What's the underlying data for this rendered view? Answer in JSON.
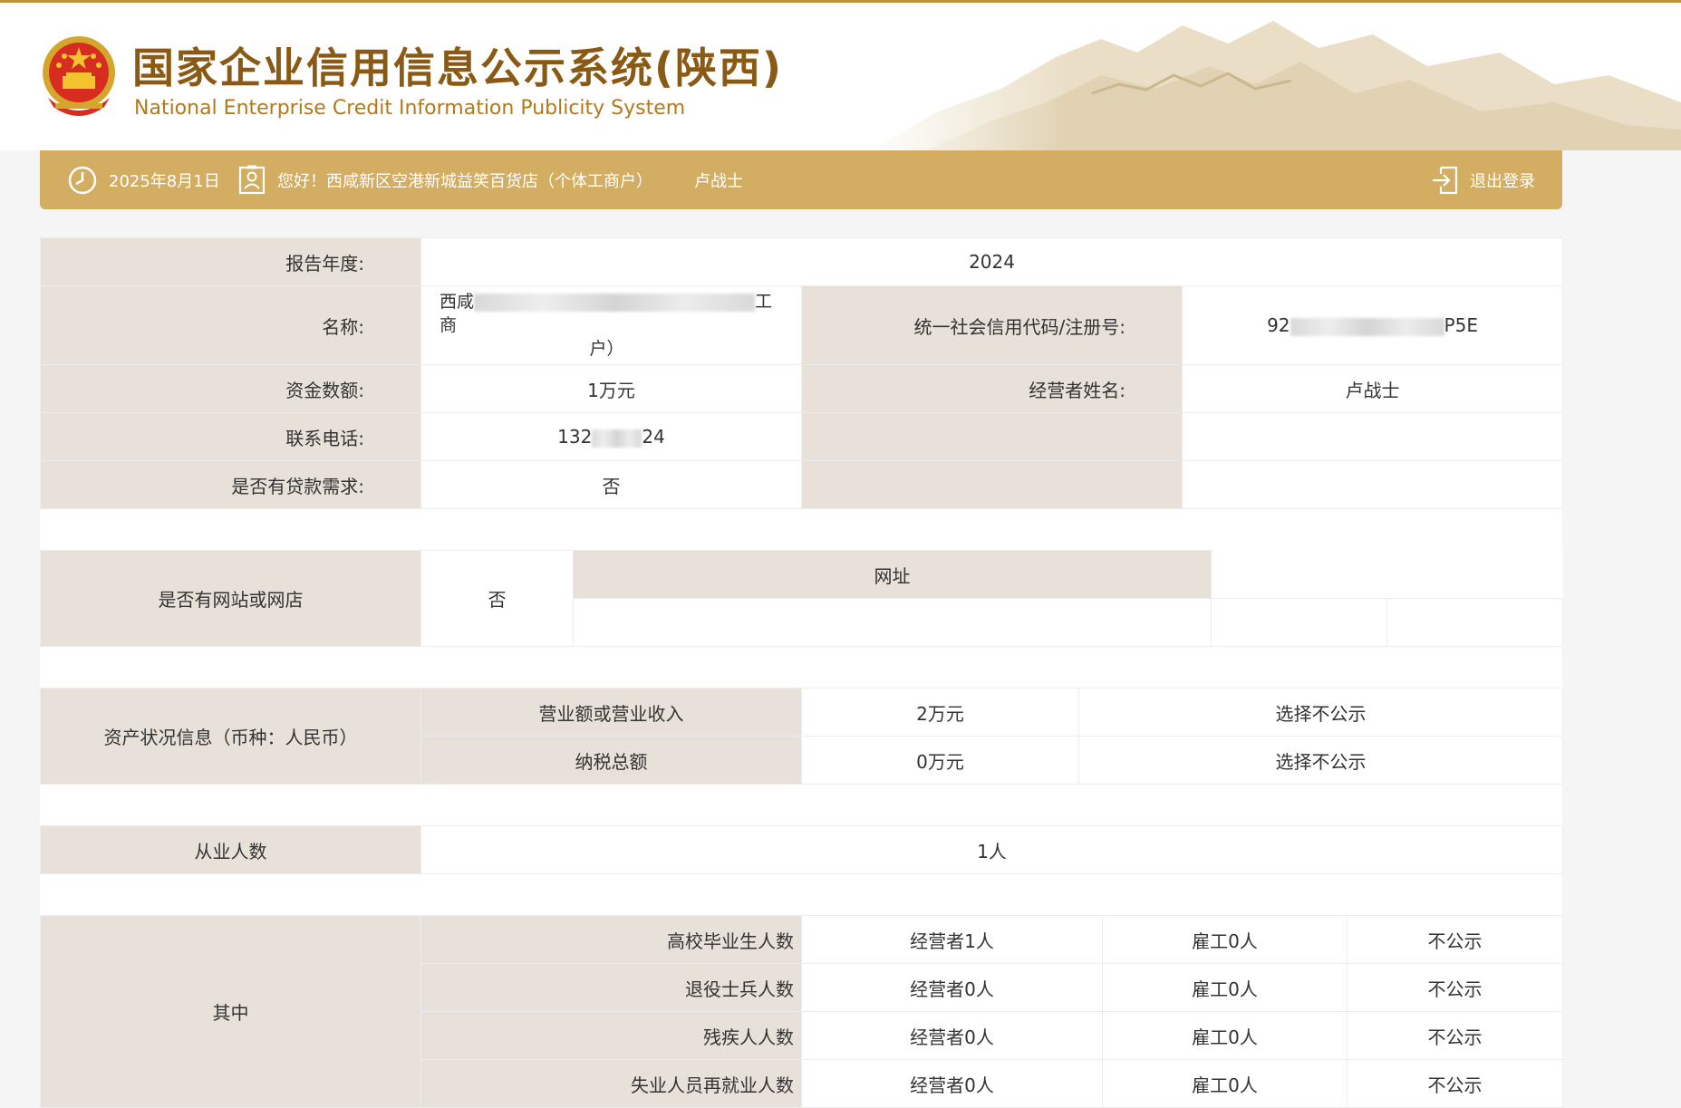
{
  "header": {
    "title_cn": "国家企业信用信息公示系统(陕西)",
    "title_en": "National Enterprise Credit Information Publicity System"
  },
  "userbar": {
    "date": "2025年8月1日",
    "greeting": "您好！西咸新区空港新城益笑百货店（个体工商户）",
    "operator": "卢战士",
    "logout": "退出登录"
  },
  "basic": {
    "year_label": "报告年度:",
    "year": "2024",
    "name_label": "名称:",
    "name_start": "西咸",
    "name_mid": "工商",
    "name_end": "户）",
    "credit_label": "统一社会信用代码/注册号:",
    "credit_start": "92",
    "credit_end": "P5E",
    "capital_label": "资金数额:",
    "capital": "1万元",
    "operator_label": "经营者姓名:",
    "operator": "卢战士",
    "phone_label": "联系电话:",
    "phone_start": "132",
    "phone_end": "24",
    "loan_label": "是否有贷款需求:",
    "loan": "否"
  },
  "website": {
    "label": "是否有网站或网店",
    "value": "否",
    "url_header": "网址"
  },
  "assets": {
    "label": "资产状况信息（币种：人民币）",
    "rows": [
      {
        "name": "营业额或营业收入",
        "value": "2万元",
        "status": "选择不公示"
      },
      {
        "name": "纳税总额",
        "value": "0万元",
        "status": "选择不公示"
      }
    ]
  },
  "employees": {
    "label": "从业人数",
    "value": "1人"
  },
  "breakdown": {
    "label": "其中",
    "rows": [
      {
        "name": "高校毕业生人数",
        "owner": "经营者1人",
        "hired": "雇工0人",
        "status": "不公示"
      },
      {
        "name": "退役士兵人数",
        "owner": "经营者0人",
        "hired": "雇工0人",
        "status": "不公示"
      },
      {
        "name": "残疾人人数",
        "owner": "经营者0人",
        "hired": "雇工0人",
        "status": "不公示"
      },
      {
        "name": "失业人员再就业人数",
        "owner": "经营者0人",
        "hired": "雇工0人",
        "status": "不公示"
      }
    ]
  }
}
